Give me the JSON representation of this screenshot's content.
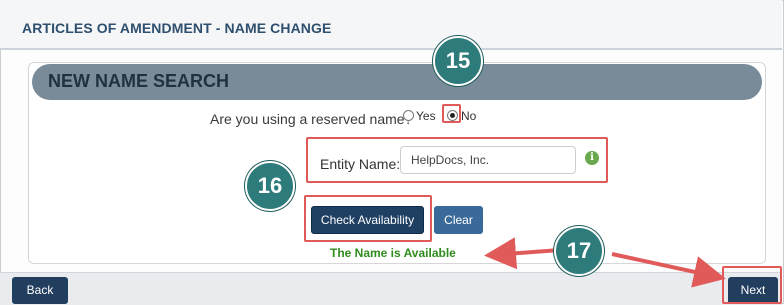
{
  "page": {
    "title": "ARTICLES OF AMENDMENT - NAME CHANGE"
  },
  "section": {
    "title": "NEW NAME SEARCH"
  },
  "reserved_question": {
    "label": "Are you using a reserved name?",
    "options": [
      "Yes",
      "No"
    ],
    "selected": "No"
  },
  "entity_name": {
    "label": "Entity Name:",
    "value": "HelpDocs, Inc."
  },
  "buttons": {
    "check": "Check Availability",
    "clear": "Clear",
    "back": "Back",
    "next": "Next"
  },
  "status": {
    "message": "The Name is Available",
    "color": "#2f8c1d"
  },
  "callouts": {
    "step_15": "15",
    "step_16": "16",
    "step_17": "17",
    "badge_color": "#2e7b7b",
    "highlight_color": "#e05a5a",
    "arrow_color": "#e05a5a"
  },
  "icons": {
    "info": "info-circle-icon"
  }
}
